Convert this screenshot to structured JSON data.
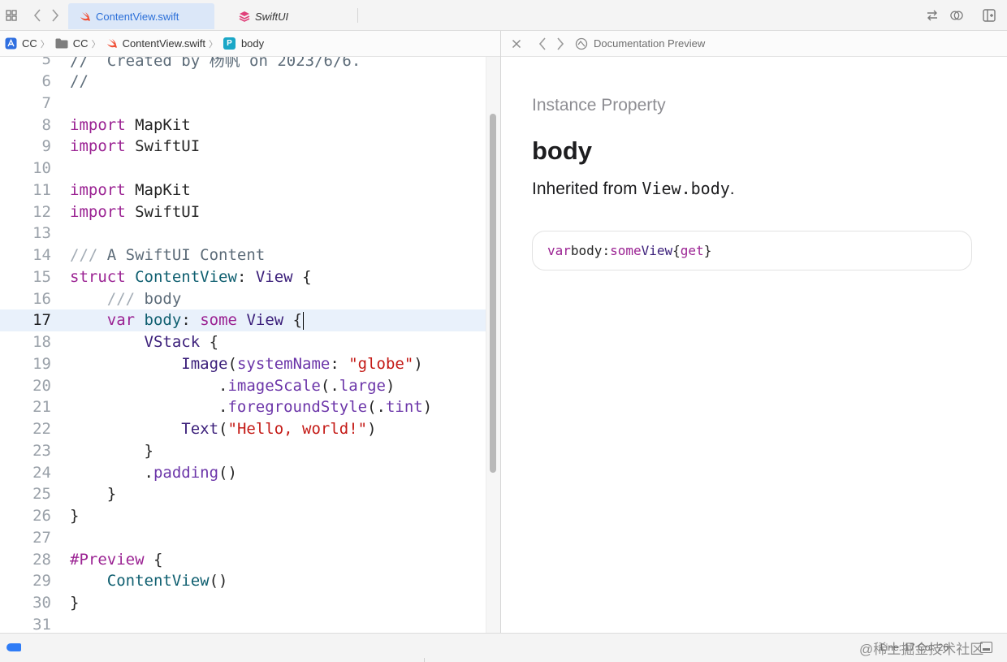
{
  "tabs": [
    {
      "label": "ContentView.swift",
      "active": true,
      "icon": "swift-icon"
    },
    {
      "label": "SwiftUI",
      "active": false,
      "icon": "framework-stack-icon"
    }
  ],
  "breadcrumb": {
    "items": [
      {
        "label": "CC",
        "icon": "project-icon"
      },
      {
        "label": "CC",
        "icon": "folder-icon"
      },
      {
        "label": "ContentView.swift",
        "icon": "swift-icon"
      },
      {
        "label": "body",
        "icon": "property-icon",
        "badge": "P"
      }
    ],
    "separator": "〉"
  },
  "editor": {
    "current_line": 17,
    "lines": [
      {
        "n": "5",
        "partial": true
      },
      {
        "n": "6"
      },
      {
        "n": "7"
      },
      {
        "n": "8"
      },
      {
        "n": "9"
      },
      {
        "n": "10"
      },
      {
        "n": "11"
      },
      {
        "n": "12"
      },
      {
        "n": "13"
      },
      {
        "n": "14"
      },
      {
        "n": "15"
      },
      {
        "n": "16"
      },
      {
        "n": "17"
      },
      {
        "n": "18"
      },
      {
        "n": "19"
      },
      {
        "n": "20"
      },
      {
        "n": "21"
      },
      {
        "n": "22"
      },
      {
        "n": "23"
      },
      {
        "n": "24"
      },
      {
        "n": "25"
      },
      {
        "n": "26"
      },
      {
        "n": "27"
      },
      {
        "n": "28"
      },
      {
        "n": "29"
      },
      {
        "n": "30"
      },
      {
        "n": "31"
      }
    ],
    "tokens": {
      "l5": {
        "comment": "//  Created by 杨帆 on 2023/6/6."
      },
      "l6": {
        "comment": "//"
      },
      "l8": {
        "kw": "import",
        "mod": "MapKit"
      },
      "l9": {
        "kw": "import",
        "mod": "SwiftUI"
      },
      "l11": {
        "kw": "import",
        "mod": "MapKit"
      },
      "l12": {
        "kw": "import",
        "mod": "SwiftUI"
      },
      "l14": {
        "doc_marker": "///",
        "text": "A SwiftUI Content"
      },
      "l15": {
        "kw": "struct",
        "name": "ContentView",
        "colon": ":",
        "type": "View",
        "brace": "{"
      },
      "l16": {
        "doc_marker": "///",
        "text": "body"
      },
      "l17": {
        "kw": "var",
        "name": "body",
        "colon": ":",
        "kw2": "some",
        "type": "View",
        "brace": "{"
      },
      "l18": {
        "type": "VStack",
        "brace": "{"
      },
      "l19": {
        "type": "Image",
        "open": "(",
        "label": "systemName",
        "colon": ":",
        "str": "\"globe\"",
        "close": ")"
      },
      "l20": {
        "dot": ".",
        "fn": "imageScale",
        "open": "(.",
        "arg": "large",
        "close": ")"
      },
      "l21": {
        "dot": ".",
        "fn": "foregroundStyle",
        "open": "(.",
        "arg": "tint",
        "close": ")"
      },
      "l22": {
        "type": "Text",
        "open": "(",
        "str": "\"Hello, world!\"",
        "close": ")"
      },
      "l23": {
        "brace": "}"
      },
      "l24": {
        "dot": ".",
        "fn": "padding",
        "parens": "()"
      },
      "l25": {
        "brace": "}"
      },
      "l26": {
        "brace": "}"
      },
      "l28": {
        "macro": "#Preview",
        "brace": "{"
      },
      "l29": {
        "name": "ContentView",
        "parens": "()"
      },
      "l30": {
        "brace": "}"
      }
    }
  },
  "doc_bar": {
    "title": "Documentation Preview",
    "icon": "doc-preview-icon"
  },
  "doc": {
    "kind": "Instance Property",
    "title": "body",
    "summary_prefix": "Inherited from ",
    "summary_code": "View.body",
    "summary_suffix": ".",
    "declaration": {
      "kw1": "var",
      "name": "body",
      "colon": ":",
      "kw2": "some",
      "type": "View",
      "open": "{",
      "kw3": "get",
      "close": "}"
    }
  },
  "status": {
    "cursor": "Line: 17  Col: 26",
    "watermark": "@稀土掘金技术社区"
  },
  "colors": {
    "keyword": "#9b2393",
    "type": "#3b1f7a",
    "project_symbol": "#0f5f70",
    "function": "#6c36a9",
    "string": "#c41a16",
    "comment": "#5d6c79",
    "active_tab": "#2b6fd8",
    "accent": "#2f7cf6"
  }
}
